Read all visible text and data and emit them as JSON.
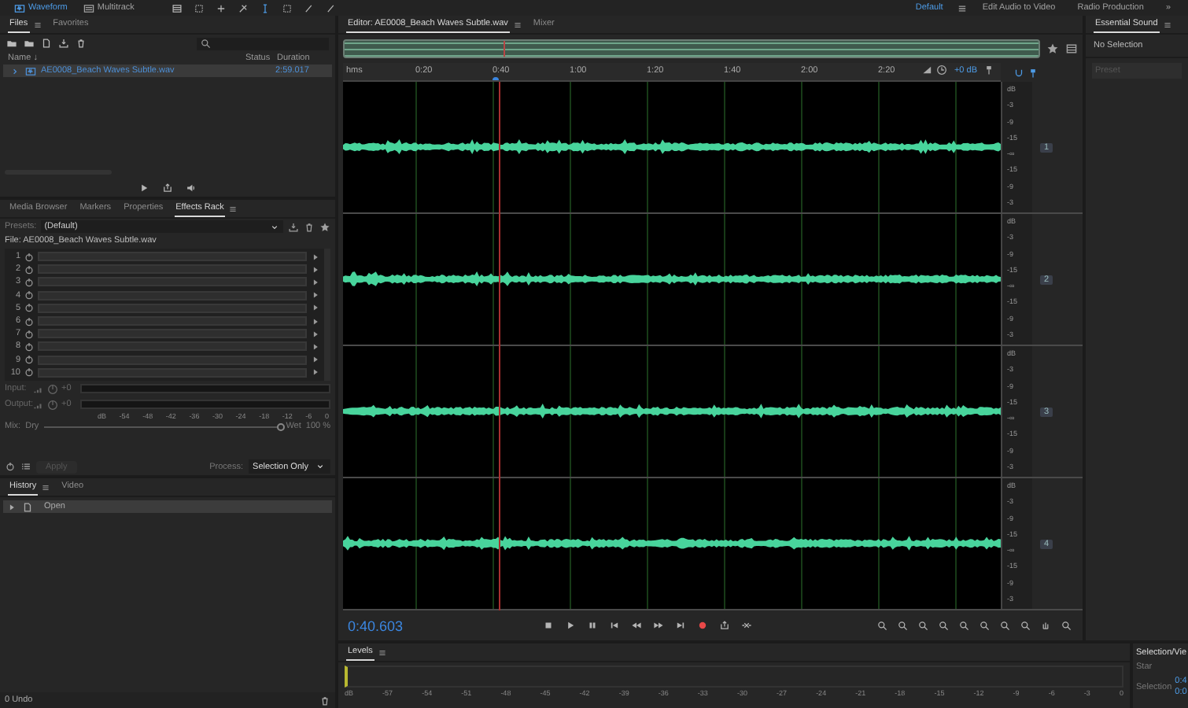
{
  "workspace_bar": {
    "modes": [
      {
        "label": "Waveform",
        "selected": true
      },
      {
        "label": "Multitrack",
        "selected": false
      }
    ],
    "workspaces": [
      {
        "label": "Default",
        "selected": true
      },
      {
        "label": "Edit Audio to Video",
        "selected": false
      },
      {
        "label": "Radio Production",
        "selected": false
      }
    ],
    "overflow": "»"
  },
  "files_panel": {
    "tabs": [
      {
        "label": "Files",
        "selected": true
      },
      {
        "label": "Favorites",
        "selected": false
      }
    ],
    "columns": [
      "Name ↓",
      "Status",
      "Duration"
    ],
    "rows": [
      {
        "name": "AE0008_Beach Waves Subtle.wav",
        "duration": "2:59.017",
        "selected": true
      }
    ]
  },
  "effects_panel": {
    "tabs": [
      {
        "label": "Media Browser",
        "selected": false
      },
      {
        "label": "Markers",
        "selected": false
      },
      {
        "label": "Properties",
        "selected": false
      },
      {
        "label": "Effects Rack",
        "selected": true
      }
    ],
    "presets_label": "Presets:",
    "preset": "(Default)",
    "file": "File: AE0008_Beach Waves Subtle.wav",
    "slots": [
      "1",
      "2",
      "3",
      "4",
      "5",
      "6",
      "7",
      "8",
      "9",
      "10"
    ],
    "input_label": "Input:",
    "input_value": "+0",
    "output_label": "Output:",
    "output_value": "+0",
    "meter_scale": [
      "dB",
      "-54",
      "-48",
      "-42",
      "-36",
      "-30",
      "-24",
      "-18",
      "-12",
      "-6",
      "0"
    ],
    "mix_label": "Mix:",
    "dry_label": "Dry",
    "wet_label": "Wet",
    "wet_amount": "100 %",
    "mix": {
      "level": 1
    },
    "apply": "Apply",
    "process_label": "Process:",
    "process": "Selection Only"
  },
  "history_panel": {
    "tabs": [
      {
        "label": "History",
        "selected": true
      },
      {
        "label": "Video",
        "selected": false
      }
    ],
    "items": [
      {
        "label": "Open",
        "selected": true
      }
    ],
    "undo_count": "0 Undo"
  },
  "editor": {
    "tabs": [
      {
        "label": "Editor: AE0008_Beach Waves Subtle.wav",
        "selected": true
      },
      {
        "label": "Mixer",
        "selected": false
      }
    ],
    "ruler": [
      "hms",
      "0:20",
      "0:40",
      "1:00",
      "1:20",
      "1:40",
      "2:00",
      "2:20"
    ],
    "gain": "+0 dB",
    "channels": [
      {
        "badge": "1",
        "scale": [
          "dB",
          "-3",
          "-9",
          "-15",
          "-∞",
          "-15",
          "-9",
          "-3"
        ]
      },
      {
        "badge": "2",
        "scale": [
          "dB",
          "-3",
          "-9",
          "-15",
          "-∞",
          "-15",
          "-9",
          "-3"
        ]
      },
      {
        "badge": "3",
        "scale": [
          "dB",
          "-3",
          "-9",
          "-15",
          "-∞",
          "-15",
          "-9",
          "-3"
        ]
      },
      {
        "badge": "4",
        "scale": [
          "dB",
          "-3",
          "-9",
          "-15",
          "-∞",
          "-15",
          "-9",
          "-3"
        ]
      }
    ],
    "time": "0:40.603"
  },
  "essential_sound": {
    "title": "Essential Sound",
    "status": "No Selection",
    "preset_label": "Preset"
  },
  "levels": {
    "title": "Levels",
    "scale": [
      "dB",
      "-57",
      "-54",
      "-51",
      "-48",
      "-45",
      "-42",
      "-39",
      "-36",
      "-33",
      "-30",
      "-27",
      "-24",
      "-21",
      "-18",
      "-15",
      "-12",
      "-9",
      "-6",
      "-3",
      "0"
    ]
  },
  "selection_view": {
    "title": "Selection/Vie",
    "start_label": "Star",
    "selection_label": "Selection",
    "values": [
      "0:4",
      "0:0"
    ]
  }
}
